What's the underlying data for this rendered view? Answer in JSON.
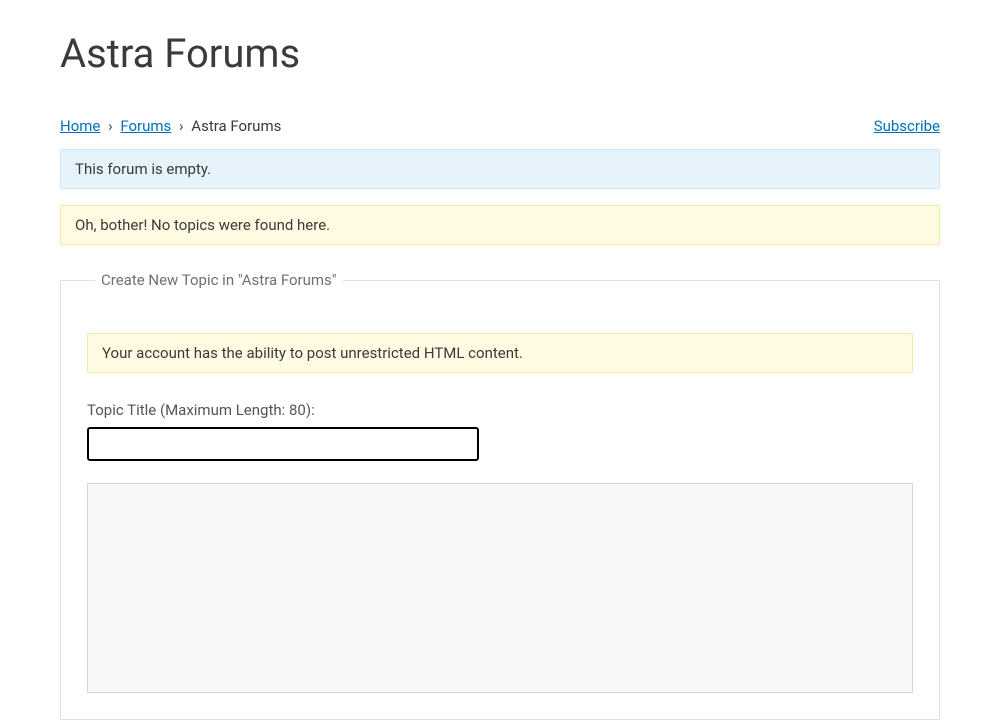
{
  "page": {
    "title": "Astra Forums"
  },
  "breadcrumbs": {
    "home": "Home",
    "forums": "Forums",
    "current": "Astra Forums",
    "separator": "›"
  },
  "actions": {
    "subscribe": "Subscribe"
  },
  "notices": {
    "empty_forum": "This forum is empty.",
    "no_topics": "Oh, bother! No topics were found here.",
    "unrestricted_html": "Your account has the ability to post unrestricted HTML content."
  },
  "new_topic": {
    "legend": "Create New Topic in \"Astra Forums\"",
    "title_label": "Topic Title (Maximum Length: 80):",
    "title_value": ""
  }
}
